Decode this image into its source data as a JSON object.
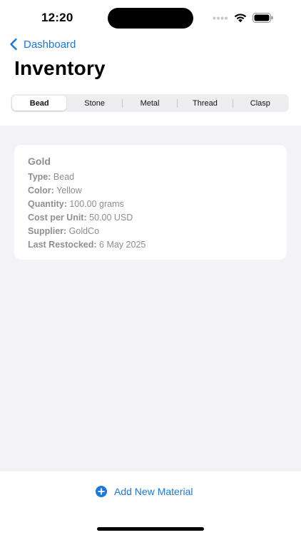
{
  "status_bar": {
    "time": "12:20"
  },
  "nav": {
    "back_label": "Dashboard"
  },
  "page": {
    "title": "Inventory"
  },
  "segments": [
    {
      "label": "Bead",
      "selected": true
    },
    {
      "label": "Stone",
      "selected": false
    },
    {
      "label": "Metal",
      "selected": false
    },
    {
      "label": "Thread",
      "selected": false
    },
    {
      "label": "Clasp",
      "selected": false
    }
  ],
  "material": {
    "name": "Gold",
    "fields": [
      {
        "key": "Type:",
        "value": "Bead"
      },
      {
        "key": "Color:",
        "value": "Yellow"
      },
      {
        "key": "Quantity:",
        "value": "100.00 grams"
      },
      {
        "key": "Cost per Unit:",
        "value": "50.00 USD"
      },
      {
        "key": "Supplier:",
        "value": "GoldCo"
      },
      {
        "key": "Last Restocked:",
        "value": "6 May 2025"
      }
    ]
  },
  "actions": {
    "add_label": "Add New Material"
  },
  "colors": {
    "accent": "#1a78e0",
    "secondary_text": "#8e8e93",
    "grouped_background": "#f2f2f7"
  },
  "icons": {
    "back": "chevron-left-icon",
    "add": "plus-circle-icon",
    "signal": "cellular-signal-icon",
    "wifi": "wifi-icon",
    "battery": "battery-icon"
  }
}
